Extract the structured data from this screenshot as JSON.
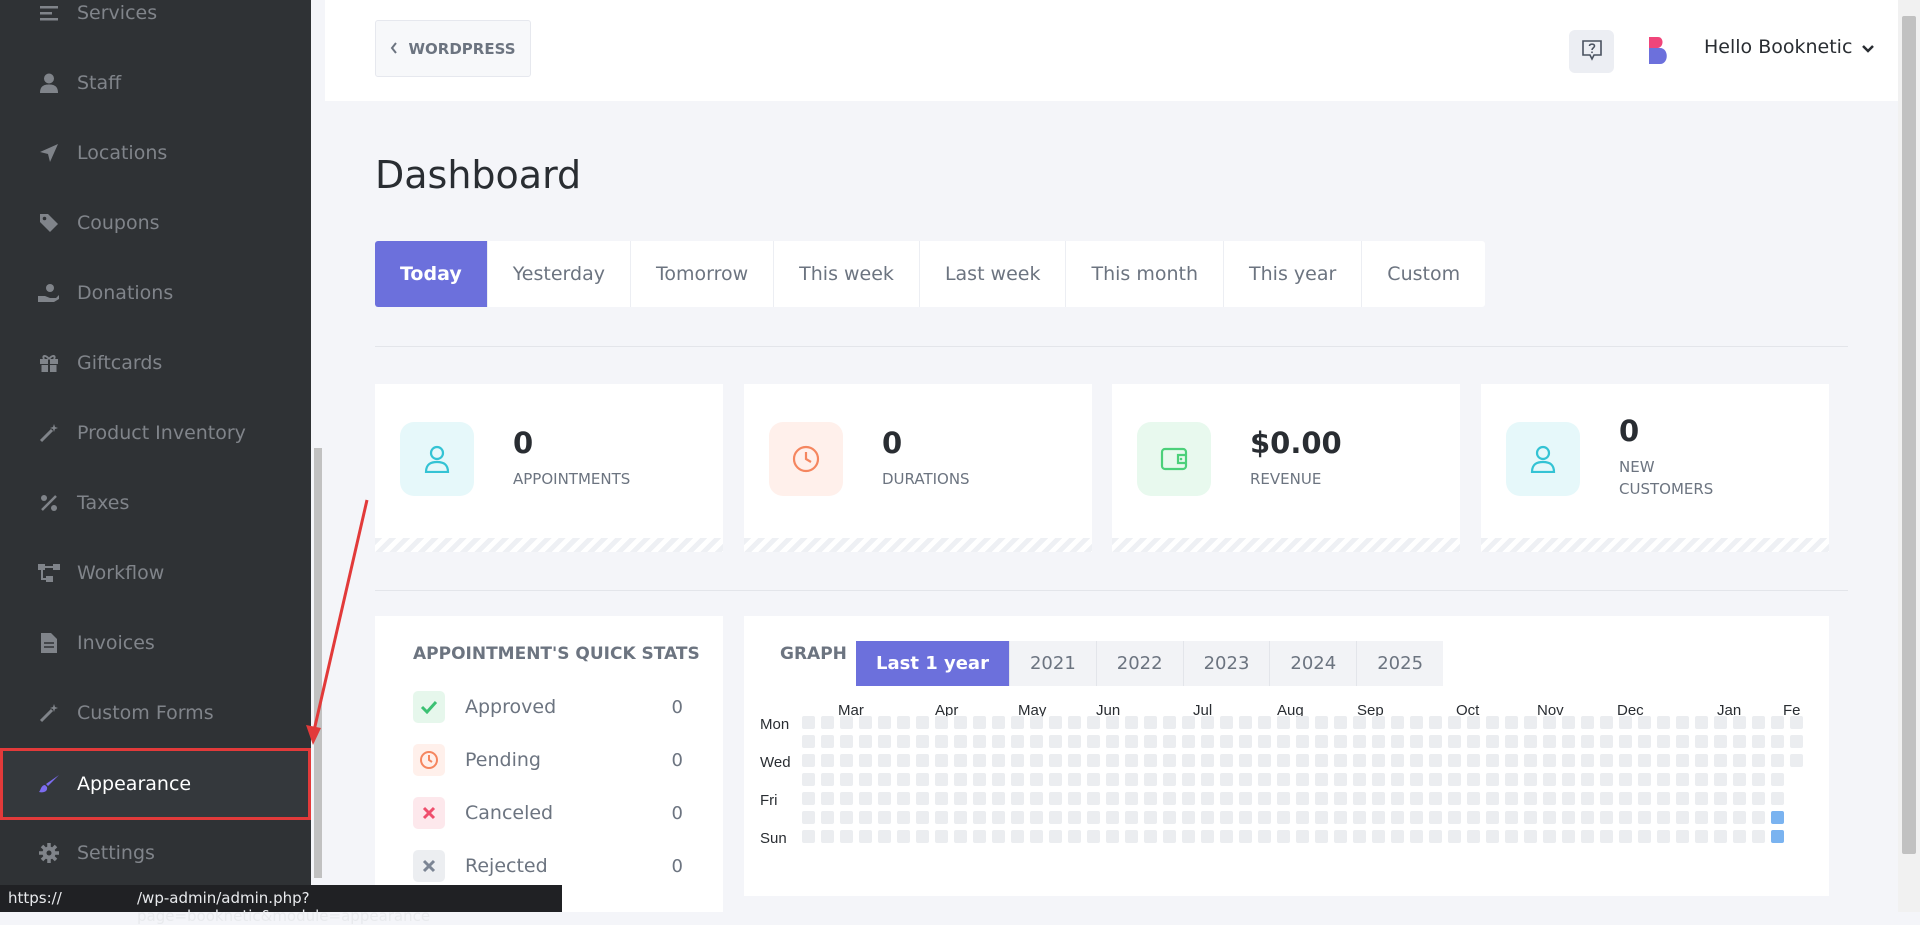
{
  "sidebar": {
    "items": [
      {
        "label": "Services",
        "icon": "list-icon",
        "active": false
      },
      {
        "label": "Staff",
        "icon": "user-icon",
        "active": false
      },
      {
        "label": "Locations",
        "icon": "location-arrow-icon",
        "active": false
      },
      {
        "label": "Coupons",
        "icon": "tag-icon",
        "active": false
      },
      {
        "label": "Donations",
        "icon": "donation-hand-icon",
        "active": false
      },
      {
        "label": "Giftcards",
        "icon": "gift-icon",
        "active": false
      },
      {
        "label": "Product Inventory",
        "icon": "magic-wand-icon",
        "active": false
      },
      {
        "label": "Taxes",
        "icon": "percent-icon",
        "active": false
      },
      {
        "label": "Workflow",
        "icon": "workflow-icon",
        "active": false
      },
      {
        "label": "Invoices",
        "icon": "file-icon",
        "active": false
      },
      {
        "label": "Custom Forms",
        "icon": "magic-wand-icon",
        "active": false
      },
      {
        "label": "Appearance",
        "icon": "paintbrush-icon",
        "active": true
      },
      {
        "label": "Settings",
        "icon": "gear-icon",
        "active": false
      }
    ]
  },
  "header": {
    "back_label": "WORDPRESS",
    "greeting": "Hello Booknetic"
  },
  "page": {
    "title": "Dashboard"
  },
  "date_tabs": [
    {
      "label": "Today",
      "active": true
    },
    {
      "label": "Yesterday",
      "active": false
    },
    {
      "label": "Tomorrow",
      "active": false
    },
    {
      "label": "This week",
      "active": false
    },
    {
      "label": "Last week",
      "active": false
    },
    {
      "label": "This month",
      "active": false
    },
    {
      "label": "This year",
      "active": false
    },
    {
      "label": "Custom",
      "active": false
    }
  ],
  "stats": [
    {
      "value": "0",
      "label": "APPOINTMENTS",
      "icon": "user-icon",
      "color": "#34c3d4",
      "bg": "#e6f8fa"
    },
    {
      "value": "0",
      "label": "DURATIONS",
      "icon": "clock-icon",
      "color": "#f5865f",
      "bg": "#fff0eb"
    },
    {
      "value": "$0.00",
      "label": "REVENUE",
      "icon": "wallet-icon",
      "color": "#4cd07a",
      "bg": "#e8f9ee"
    },
    {
      "value": "0",
      "label_line1": "NEW",
      "label_line2": "CUSTOMERS",
      "icon": "user-icon",
      "color": "#34c3d4",
      "bg": "#e6f8fa"
    }
  ],
  "quick_stats": {
    "title": "APPOINTMENT'S QUICK STATS",
    "rows": [
      {
        "label": "Approved",
        "value": "0",
        "icon": "check-icon",
        "color": "#3cc173",
        "bg": "#e6f7ec"
      },
      {
        "label": "Pending",
        "value": "0",
        "icon": "clock-icon",
        "color": "#f5865f",
        "bg": "#fff0eb"
      },
      {
        "label": "Canceled",
        "value": "0",
        "icon": "close-icon",
        "color": "#ef4f6d",
        "bg": "#fde8ec"
      },
      {
        "label": "Rejected",
        "value": "0",
        "icon": "close-icon",
        "color": "#7c8594",
        "bg": "#eceef1"
      }
    ]
  },
  "graph": {
    "title": "GRAPH",
    "year_tabs": [
      {
        "label": "Last 1 year",
        "active": true
      },
      {
        "label": "2021",
        "active": false
      },
      {
        "label": "2022",
        "active": false
      },
      {
        "label": "2023",
        "active": false
      },
      {
        "label": "2024",
        "active": false
      },
      {
        "label": "2025",
        "active": false
      }
    ],
    "months": [
      "Mar",
      "Apr",
      "May",
      "Jun",
      "Jul",
      "Aug",
      "Sep",
      "Oct",
      "Nov",
      "Dec",
      "Jan",
      "Fe"
    ],
    "days": [
      "Mon",
      "Wed",
      "Fri",
      "Sun"
    ]
  },
  "status_bar": {
    "left": "https://",
    "right": "/wp-admin/admin.php?page=booknetic&module=appearance"
  },
  "colors": {
    "accent": "#6c70dc",
    "sidebar_bg": "#2f3235",
    "highlight": "#e23a3a",
    "heat_empty": "#ebedf0",
    "heat_active": "#7ab3f0"
  }
}
